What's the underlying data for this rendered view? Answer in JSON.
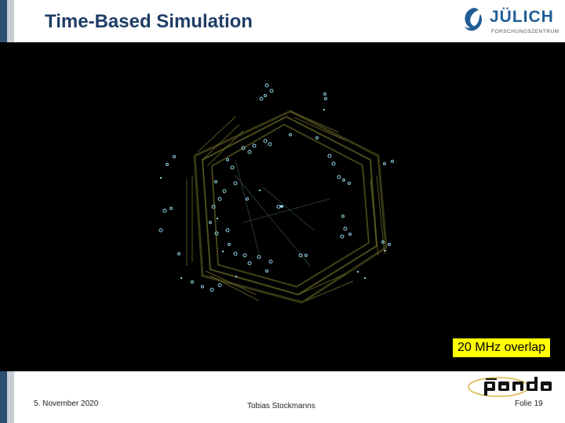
{
  "slide": {
    "title": "Time-Based Simulation",
    "badge": "20 MHz overlap"
  },
  "logo": {
    "name": "JÜLICH",
    "subtitle": "FORSCHUNGSZENTRUM"
  },
  "footer": {
    "date": "5. November 2020",
    "author": "Tobias Stockmanns",
    "page": "Folie 19"
  },
  "colors": {
    "title": "#1f3d66",
    "badge_bg": "#ffff00",
    "detector": "#5a5a22",
    "hits": "#8fd3e6"
  }
}
